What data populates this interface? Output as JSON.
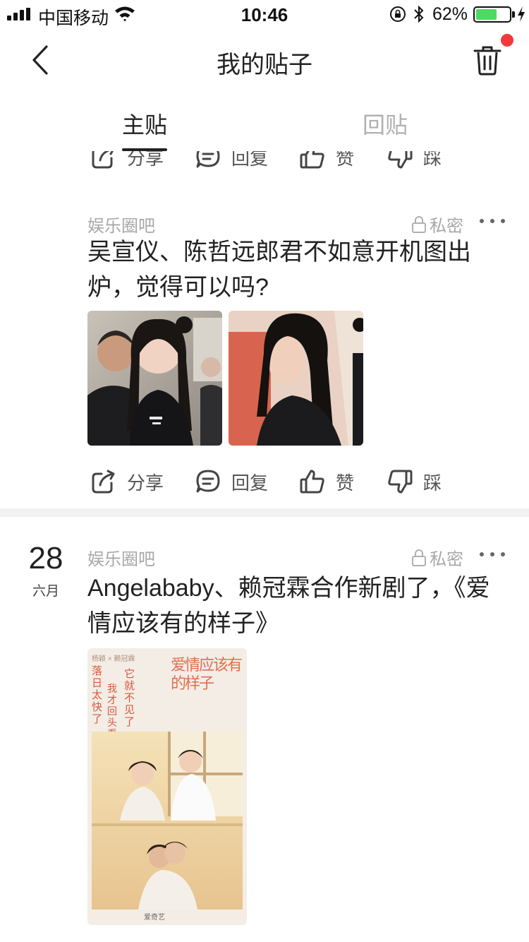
{
  "status_bar": {
    "carrier": "中国移动",
    "time": "10:46",
    "battery_percent": "62%",
    "battery_level": 0.62,
    "battery_color": "#4cd964"
  },
  "nav": {
    "back_icon": "chevron-left-icon",
    "title": "我的贴子",
    "trash_icon": "trash-icon",
    "badge_color": "#f23a3a"
  },
  "tabs": [
    {
      "label": "主贴",
      "active": true
    },
    {
      "label": "回贴",
      "active": false
    }
  ],
  "actions": {
    "share": "分享",
    "reply": "回复",
    "like": "赞",
    "dislike": "踩"
  },
  "posts": [
    {
      "forum": "娱乐圈吧",
      "privacy": "私密",
      "title": "吴宣仪、陈哲远郎君不如意开机图出炉，觉得可以吗?",
      "images": [
        "photo-woman-black-tshirt",
        "photo-man-long-hair"
      ]
    },
    {
      "date_day": "28",
      "date_month": "六月",
      "forum": "娱乐圈吧",
      "privacy": "私密",
      "title": "Angelababy、赖冠霖合作新剧了，《爱情应该有的样子》",
      "images": [
        "drama-poster"
      ],
      "poster_text": {
        "cast": "杨颖 × 赖冠霖",
        "poem_a": "落日太快了",
        "poem_b": "它就不见了",
        "poem_c": "我才回头看你一眼",
        "title": "爱情应该有的样子",
        "platform": "爱奇艺"
      }
    }
  ]
}
